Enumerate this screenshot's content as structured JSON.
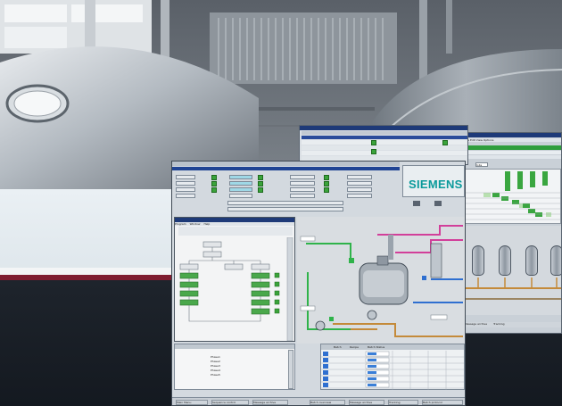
{
  "brand": {
    "name": "SIEMENS",
    "color": "#0a9a9b"
  },
  "colors": {
    "title_bar": "#1e3a78",
    "status_ok": "#3aa33a",
    "pipe_magenta": "#d23f9a",
    "pipe_green": "#2fb34a",
    "pipe_blue": "#2f6fd0",
    "stripe_red": "#7f1d30"
  },
  "icons": [
    "status-green-icon",
    "valve-icon",
    "pump-icon",
    "tank-icon",
    "scrollbar-icon"
  ],
  "photo": {
    "description_visible_text": ""
  },
  "back_window": {
    "menu": [
      "File",
      "Edit",
      "View",
      "Options"
    ],
    "tabs": [
      "Jobs"
    ],
    "footer": [
      "Message archive",
      "Tracking",
      "Batch protocol"
    ]
  },
  "main_window": {
    "top_cols": [
      "Sel",
      "Type",
      "Designation",
      "Batch",
      "State",
      "Mode",
      "Setpoint",
      "Actual",
      "Unit",
      "Phase",
      "Step",
      "Time"
    ],
    "sequence_window": {
      "title": "Sequence",
      "menu": [
        "Program",
        "Window",
        "Help"
      ]
    },
    "step_table_rows": [
      "Phase1",
      "Phase2",
      "Phase3",
      "Phase4",
      "Phase5"
    ],
    "batch_table": {
      "headers": [
        "Batch",
        "Recipe",
        "Batch Status",
        "Unit",
        "Unit",
        "Unit",
        "Unit"
      ],
      "rows": [
        [
          "1",
          "0",
          "Released",
          "Setpoint",
          "Setpoint",
          "Setpoint",
          "Setpoint"
        ],
        [
          "2",
          "0",
          "Released",
          "Setpoint",
          "Setpoint",
          "Setpoint",
          "Setpoint"
        ],
        [
          "3",
          "0",
          "Released",
          "Setpoint",
          "Setpoint",
          "Setpoint",
          "Setpoint"
        ],
        [
          "4",
          "0",
          "Released",
          "Setpoint",
          "Setpoint",
          "Setpoint",
          "Setpoint"
        ],
        [
          "5",
          "0",
          "Released",
          "Setpoint",
          "Setpoint",
          "Setpoint",
          "Setpoint"
        ],
        [
          "6",
          "0",
          "Released",
          "Setpoint",
          "Setpoint",
          "Setpoint",
          "Setpoint"
        ]
      ]
    },
    "taskbar": [
      "Main Menu",
      "Sequence control",
      "Message archive",
      "Batch overview",
      "Message archive",
      "Tracking",
      "Batch protocol"
    ]
  }
}
